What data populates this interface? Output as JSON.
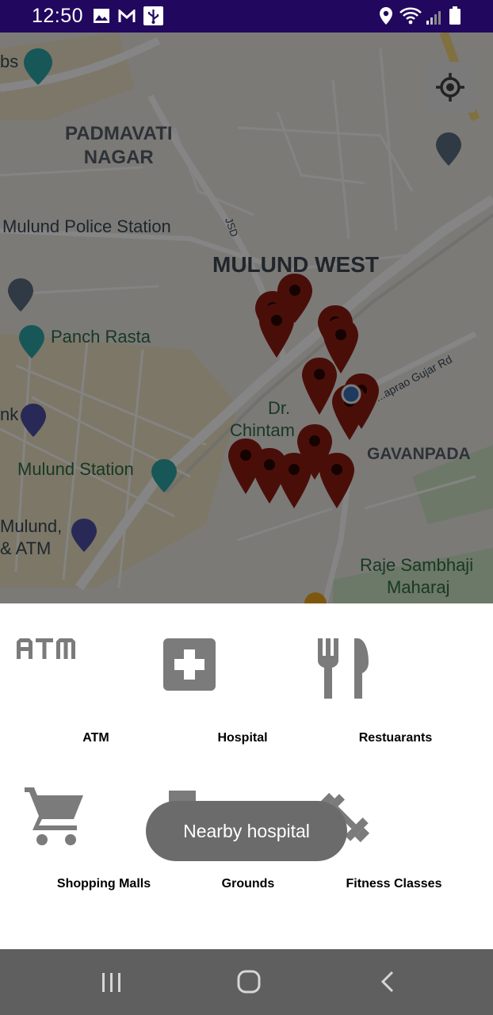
{
  "status_bar": {
    "time": "12:50",
    "icons": [
      "image-icon",
      "gmail-icon",
      "usb-icon",
      "location-icon",
      "wifi-icon",
      "signal-icon",
      "battery-icon"
    ]
  },
  "map": {
    "labels": {
      "edge_bs": "bs",
      "padmavati": "PADMAVATI\nNAGAR",
      "police": "Mulund Police Station",
      "jsd": "JSD",
      "mulund_west": "MULUND WEST",
      "panch_rasta": "Panch Rasta",
      "dr": "Dr.",
      "chintam": "Chintam",
      "gujar": "...aprao Gujar Rd",
      "gavanpada": "GAVANPADA",
      "edge_nk": "nk",
      "mulund_station": "Mulund Station",
      "mulund_atm_1": "Mulund,",
      "mulund_atm_2": "& ATM",
      "raje": "Raje Sambhaji",
      "maharaj": "Maharaj"
    },
    "marker_count": 14,
    "colors": {
      "marker": "#8f1b13",
      "my_location": "#3b6fb6",
      "dim": "rgba(0,0,0,0.48)"
    }
  },
  "categories": [
    {
      "label": "ATM",
      "icon": "atm-icon"
    },
    {
      "label": "Hospital",
      "icon": "hospital-icon"
    },
    {
      "label": "Restuarants",
      "icon": "restaurant-icon"
    },
    {
      "label": "Shopping Malls",
      "icon": "shopping-cart-icon"
    },
    {
      "label": "Grounds",
      "icon": "grounds-icon"
    },
    {
      "label": "Fitness Classes",
      "icon": "dumbbell-icon"
    }
  ],
  "toast": {
    "text": "Nearby hospital"
  },
  "nav": {
    "buttons": [
      "recents-icon",
      "home-icon",
      "back-icon"
    ]
  },
  "colors": {
    "status_bar": "#22075e",
    "icon_gray": "#7b7b7b",
    "toast_bg": "#6b6b6b",
    "navbar": "#5f5f5f"
  }
}
